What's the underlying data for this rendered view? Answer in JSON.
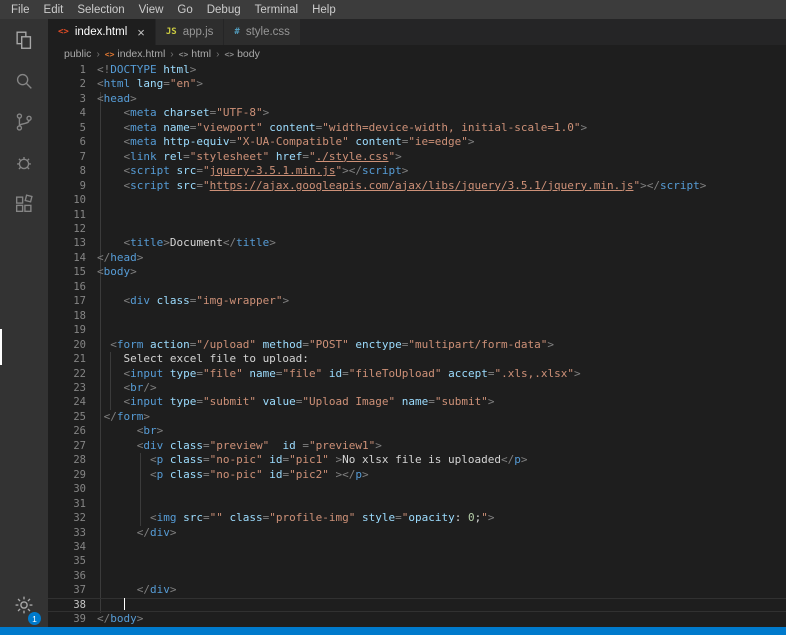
{
  "colors": {
    "accent": "#007acc",
    "editor_bg": "#1e1e1e",
    "activity_bar_bg": "#333333",
    "tab_bar_bg": "#252526",
    "menu_bar_bg": "#3c3c3c",
    "html_icon": "#e44d26",
    "js_icon": "#cbcb41",
    "css_icon": "#519aba"
  },
  "menu_bar": {
    "items": [
      "File",
      "Edit",
      "Selection",
      "View",
      "Go",
      "Debug",
      "Terminal",
      "Help"
    ]
  },
  "activity_bar": {
    "items": [
      "explorer",
      "search",
      "source-control",
      "debug",
      "extensions",
      "settings"
    ],
    "settings_badge": "1"
  },
  "tabs": [
    {
      "label": "index.html",
      "icon": "html",
      "icon_glyph": "<>",
      "active": true,
      "close_glyph": "×"
    },
    {
      "label": "app.js",
      "icon": "js",
      "icon_glyph": "JS",
      "active": false
    },
    {
      "label": "style.css",
      "icon": "css",
      "icon_glyph": "#",
      "active": false
    }
  ],
  "breadcrumb": {
    "separator": "›",
    "items": [
      {
        "label": "public"
      },
      {
        "label": "index.html",
        "icon": "html",
        "icon_glyph": "<>"
      },
      {
        "label": "html",
        "icon": "tag",
        "icon_glyph": "<>"
      },
      {
        "label": "body",
        "icon": "tag",
        "icon_glyph": "<>"
      }
    ]
  },
  "editor": {
    "lines": [
      {
        "n": 1,
        "t": [
          [
            "p",
            "<!"
          ],
          [
            "t",
            "DOCTYPE"
          ],
          [
            "x",
            " "
          ],
          [
            "a",
            "html"
          ],
          [
            "p",
            ">"
          ]
        ]
      },
      {
        "n": 2,
        "t": [
          [
            "p",
            "<"
          ],
          [
            "t",
            "html"
          ],
          [
            "x",
            " "
          ],
          [
            "a",
            "lang"
          ],
          [
            "p",
            "="
          ],
          [
            "s",
            "\"en\""
          ],
          [
            "p",
            ">"
          ]
        ]
      },
      {
        "n": 3,
        "t": [
          [
            "p",
            "<"
          ],
          [
            "t",
            "head"
          ],
          [
            "p",
            ">"
          ]
        ]
      },
      {
        "n": 4,
        "t": [
          [
            "x",
            "    "
          ],
          [
            "p",
            "<"
          ],
          [
            "t",
            "meta"
          ],
          [
            "x",
            " "
          ],
          [
            "a",
            "charset"
          ],
          [
            "p",
            "="
          ],
          [
            "s",
            "\"UTF-8\""
          ],
          [
            "p",
            ">"
          ]
        ]
      },
      {
        "n": 5,
        "t": [
          [
            "x",
            "    "
          ],
          [
            "p",
            "<"
          ],
          [
            "t",
            "meta"
          ],
          [
            "x",
            " "
          ],
          [
            "a",
            "name"
          ],
          [
            "p",
            "="
          ],
          [
            "s",
            "\"viewport\""
          ],
          [
            "x",
            " "
          ],
          [
            "a",
            "content"
          ],
          [
            "p",
            "="
          ],
          [
            "s",
            "\"width=device-width, initial-scale=1.0\""
          ],
          [
            "p",
            ">"
          ]
        ]
      },
      {
        "n": 6,
        "t": [
          [
            "x",
            "    "
          ],
          [
            "p",
            "<"
          ],
          [
            "t",
            "meta"
          ],
          [
            "x",
            " "
          ],
          [
            "a",
            "http-equiv"
          ],
          [
            "p",
            "="
          ],
          [
            "s",
            "\"X-UA-Compatible\""
          ],
          [
            "x",
            " "
          ],
          [
            "a",
            "content"
          ],
          [
            "p",
            "="
          ],
          [
            "s",
            "\"ie=edge\""
          ],
          [
            "p",
            ">"
          ]
        ]
      },
      {
        "n": 7,
        "t": [
          [
            "x",
            "    "
          ],
          [
            "p",
            "<"
          ],
          [
            "t",
            "link"
          ],
          [
            "x",
            " "
          ],
          [
            "a",
            "rel"
          ],
          [
            "p",
            "="
          ],
          [
            "s",
            "\"stylesheet\""
          ],
          [
            "x",
            " "
          ],
          [
            "a",
            "href"
          ],
          [
            "p",
            "="
          ],
          [
            "s",
            "\""
          ],
          [
            "u",
            "./style.css"
          ],
          [
            "s",
            "\""
          ],
          [
            "p",
            ">"
          ]
        ]
      },
      {
        "n": 8,
        "t": [
          [
            "x",
            "    "
          ],
          [
            "p",
            "<"
          ],
          [
            "t",
            "script"
          ],
          [
            "x",
            " "
          ],
          [
            "a",
            "src"
          ],
          [
            "p",
            "="
          ],
          [
            "s",
            "\""
          ],
          [
            "u",
            "jquery-3.5.1.min.js"
          ],
          [
            "s",
            "\""
          ],
          [
            "p",
            "></"
          ],
          [
            "t",
            "script"
          ],
          [
            "p",
            ">"
          ]
        ]
      },
      {
        "n": 9,
        "t": [
          [
            "x",
            "    "
          ],
          [
            "p",
            "<"
          ],
          [
            "t",
            "script"
          ],
          [
            "x",
            " "
          ],
          [
            "a",
            "src"
          ],
          [
            "p",
            "="
          ],
          [
            "s",
            "\""
          ],
          [
            "u",
            "https://ajax.googleapis.com/ajax/libs/jquery/3.5.1/jquery.min.js"
          ],
          [
            "s",
            "\""
          ],
          [
            "p",
            "></"
          ],
          [
            "t",
            "script"
          ],
          [
            "p",
            ">"
          ]
        ]
      },
      {
        "n": 10,
        "t": []
      },
      {
        "n": 11,
        "t": []
      },
      {
        "n": 12,
        "t": []
      },
      {
        "n": 13,
        "t": [
          [
            "x",
            "    "
          ],
          [
            "p",
            "<"
          ],
          [
            "t",
            "title"
          ],
          [
            "p",
            ">"
          ],
          [
            "x",
            "Document"
          ],
          [
            "p",
            "</"
          ],
          [
            "t",
            "title"
          ],
          [
            "p",
            ">"
          ]
        ]
      },
      {
        "n": 14,
        "t": [
          [
            "p",
            "</"
          ],
          [
            "t",
            "head"
          ],
          [
            "p",
            ">"
          ]
        ]
      },
      {
        "n": 15,
        "t": [
          [
            "p",
            "<"
          ],
          [
            "t",
            "body"
          ],
          [
            "p",
            ">"
          ]
        ]
      },
      {
        "n": 16,
        "t": []
      },
      {
        "n": 17,
        "t": [
          [
            "x",
            "    "
          ],
          [
            "p",
            "<"
          ],
          [
            "t",
            "div"
          ],
          [
            "x",
            " "
          ],
          [
            "a",
            "class"
          ],
          [
            "p",
            "="
          ],
          [
            "s",
            "\"img-wrapper\""
          ],
          [
            "p",
            ">"
          ]
        ]
      },
      {
        "n": 18,
        "t": []
      },
      {
        "n": 19,
        "t": []
      },
      {
        "n": 20,
        "t": [
          [
            "x",
            "  "
          ],
          [
            "p",
            "<"
          ],
          [
            "t",
            "form"
          ],
          [
            "x",
            " "
          ],
          [
            "a",
            "action"
          ],
          [
            "p",
            "="
          ],
          [
            "s",
            "\"/upload\""
          ],
          [
            "x",
            " "
          ],
          [
            "a",
            "method"
          ],
          [
            "p",
            "="
          ],
          [
            "s",
            "\"POST\""
          ],
          [
            "x",
            " "
          ],
          [
            "a",
            "enctype"
          ],
          [
            "p",
            "="
          ],
          [
            "s",
            "\"multipart/form-data\""
          ],
          [
            "p",
            ">"
          ]
        ]
      },
      {
        "n": 21,
        "t": [
          [
            "x",
            "    Select excel file to upload:"
          ]
        ]
      },
      {
        "n": 22,
        "t": [
          [
            "x",
            "    "
          ],
          [
            "p",
            "<"
          ],
          [
            "t",
            "input"
          ],
          [
            "x",
            " "
          ],
          [
            "a",
            "type"
          ],
          [
            "p",
            "="
          ],
          [
            "s",
            "\"file\""
          ],
          [
            "x",
            " "
          ],
          [
            "a",
            "name"
          ],
          [
            "p",
            "="
          ],
          [
            "s",
            "\"file\""
          ],
          [
            "x",
            " "
          ],
          [
            "a",
            "id"
          ],
          [
            "p",
            "="
          ],
          [
            "s",
            "\"fileToUpload\""
          ],
          [
            "x",
            " "
          ],
          [
            "a",
            "accept"
          ],
          [
            "p",
            "="
          ],
          [
            "s",
            "\".xls,.xlsx\""
          ],
          [
            "p",
            ">"
          ]
        ]
      },
      {
        "n": 23,
        "t": [
          [
            "x",
            "    "
          ],
          [
            "p",
            "<"
          ],
          [
            "t",
            "br"
          ],
          [
            "p",
            "/>"
          ]
        ]
      },
      {
        "n": 24,
        "t": [
          [
            "x",
            "    "
          ],
          [
            "p",
            "<"
          ],
          [
            "t",
            "input"
          ],
          [
            "x",
            " "
          ],
          [
            "a",
            "type"
          ],
          [
            "p",
            "="
          ],
          [
            "s",
            "\"submit\""
          ],
          [
            "x",
            " "
          ],
          [
            "a",
            "value"
          ],
          [
            "p",
            "="
          ],
          [
            "s",
            "\"Upload Image\""
          ],
          [
            "x",
            " "
          ],
          [
            "a",
            "name"
          ],
          [
            "p",
            "="
          ],
          [
            "s",
            "\"submit\""
          ],
          [
            "p",
            ">"
          ]
        ]
      },
      {
        "n": 25,
        "t": [
          [
            "x",
            " "
          ],
          [
            "p",
            "</"
          ],
          [
            "t",
            "form"
          ],
          [
            "p",
            ">"
          ]
        ]
      },
      {
        "n": 26,
        "t": [
          [
            "x",
            "      "
          ],
          [
            "p",
            "<"
          ],
          [
            "t",
            "br"
          ],
          [
            "p",
            ">"
          ]
        ]
      },
      {
        "n": 27,
        "t": [
          [
            "x",
            "      "
          ],
          [
            "p",
            "<"
          ],
          [
            "t",
            "div"
          ],
          [
            "x",
            " "
          ],
          [
            "a",
            "class"
          ],
          [
            "p",
            "="
          ],
          [
            "s",
            "\"preview\""
          ],
          [
            "x",
            "  "
          ],
          [
            "a",
            "id"
          ],
          [
            "x",
            " "
          ],
          [
            "p",
            "="
          ],
          [
            "s",
            "\"preview1\""
          ],
          [
            "p",
            ">"
          ]
        ]
      },
      {
        "n": 28,
        "t": [
          [
            "x",
            "        "
          ],
          [
            "p",
            "<"
          ],
          [
            "t",
            "p"
          ],
          [
            "x",
            " "
          ],
          [
            "a",
            "class"
          ],
          [
            "p",
            "="
          ],
          [
            "s",
            "\"no-pic\""
          ],
          [
            "x",
            " "
          ],
          [
            "a",
            "id"
          ],
          [
            "p",
            "="
          ],
          [
            "s",
            "\"pic1\""
          ],
          [
            "x",
            " "
          ],
          [
            "p",
            ">"
          ],
          [
            "x",
            "No xlsx file is uploaded"
          ],
          [
            "p",
            "</"
          ],
          [
            "t",
            "p"
          ],
          [
            "p",
            ">"
          ]
        ]
      },
      {
        "n": 29,
        "t": [
          [
            "x",
            "        "
          ],
          [
            "p",
            "<"
          ],
          [
            "t",
            "p"
          ],
          [
            "x",
            " "
          ],
          [
            "a",
            "class"
          ],
          [
            "p",
            "="
          ],
          [
            "s",
            "\"no-pic\""
          ],
          [
            "x",
            " "
          ],
          [
            "a",
            "id"
          ],
          [
            "p",
            "="
          ],
          [
            "s",
            "\"pic2\""
          ],
          [
            "x",
            " "
          ],
          [
            "p",
            "></"
          ],
          [
            "t",
            "p"
          ],
          [
            "p",
            ">"
          ]
        ]
      },
      {
        "n": 30,
        "t": []
      },
      {
        "n": 31,
        "t": []
      },
      {
        "n": 32,
        "t": [
          [
            "x",
            "        "
          ],
          [
            "p",
            "<"
          ],
          [
            "t",
            "img"
          ],
          [
            "x",
            " "
          ],
          [
            "a",
            "src"
          ],
          [
            "p",
            "="
          ],
          [
            "s",
            "\"\""
          ],
          [
            "x",
            " "
          ],
          [
            "a",
            "class"
          ],
          [
            "p",
            "="
          ],
          [
            "s",
            "\"profile-img\""
          ],
          [
            "x",
            " "
          ],
          [
            "a",
            "style"
          ],
          [
            "p",
            "="
          ],
          [
            "s",
            "\""
          ],
          [
            "a",
            "opacity"
          ],
          [
            "x",
            ": "
          ],
          [
            "n",
            "0"
          ],
          [
            "x",
            ";"
          ],
          [
            "s",
            "\""
          ],
          [
            "p",
            ">"
          ]
        ]
      },
      {
        "n": 33,
        "t": [
          [
            "x",
            "      "
          ],
          [
            "p",
            "</"
          ],
          [
            "t",
            "div"
          ],
          [
            "p",
            ">"
          ]
        ]
      },
      {
        "n": 34,
        "t": []
      },
      {
        "n": 35,
        "t": []
      },
      {
        "n": 36,
        "t": []
      },
      {
        "n": 37,
        "t": [
          [
            "x",
            "      "
          ],
          [
            "p",
            "</"
          ],
          [
            "t",
            "div"
          ],
          [
            "p",
            ">"
          ]
        ]
      },
      {
        "n": 38,
        "t": [
          [
            "x",
            "    "
          ]
        ],
        "cursor": true,
        "current": true
      },
      {
        "n": 39,
        "t": [
          [
            "p",
            "</"
          ],
          [
            "t",
            "body"
          ],
          [
            "p",
            ">"
          ]
        ]
      }
    ]
  }
}
